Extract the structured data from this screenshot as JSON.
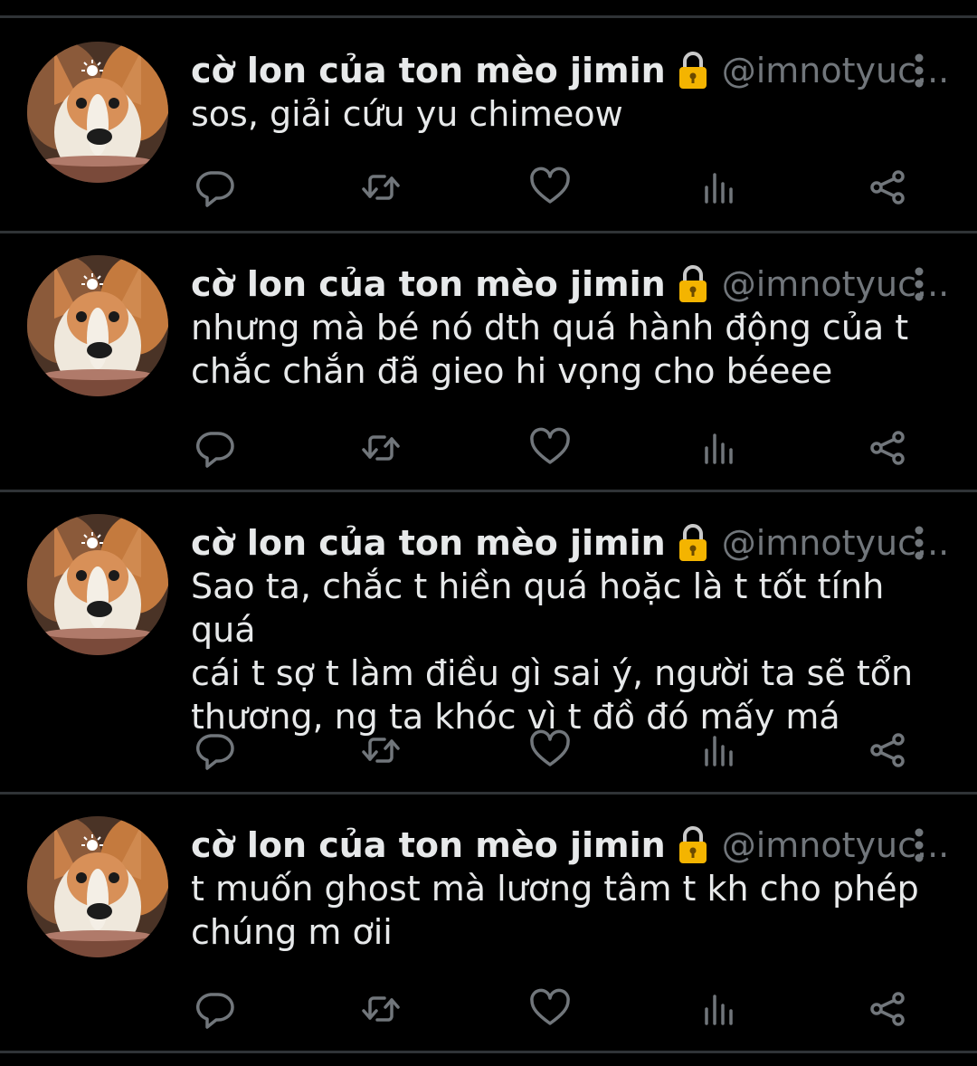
{
  "colors": {
    "background": "#000000",
    "divider": "#2f3336",
    "text": "#e7e9ea",
    "muted": "#71767b",
    "lock_gold": "#f4b400"
  },
  "icons": {
    "avatar": "corgi-avatar",
    "lock": "lock-icon",
    "more": "more-vertical-icon",
    "actions": [
      "reply-icon",
      "retweet-icon",
      "like-icon",
      "views-icon",
      "share-icon"
    ]
  },
  "tweets": [
    {
      "name": "cờ lon của ton mèo jimin",
      "handle": "@imnotyuc...",
      "text": "sos, giải cứu yu chimeow"
    },
    {
      "name": "cờ lon của ton mèo jimin",
      "handle": "@imnotyuc...",
      "text": "nhưng mà bé nó dth quá hành động của t\nchắc chắn đã gieo hi vọng cho béeee"
    },
    {
      "name": "cờ lon của ton mèo jimin",
      "handle": "@imnotyuc...",
      "text": "Sao ta, chắc t hiền quá hoặc là t tốt tính quá\ncái t sợ t làm điều gì sai ý, người ta sẽ tổn\nthương, ng ta khóc vì t đồ đó mấy má"
    },
    {
      "name": "cờ lon của ton mèo jimin",
      "handle": "@imnotyuc...",
      "text": "t muốn ghost mà lương tâm t kh cho phép\nchúng m ơii"
    }
  ]
}
